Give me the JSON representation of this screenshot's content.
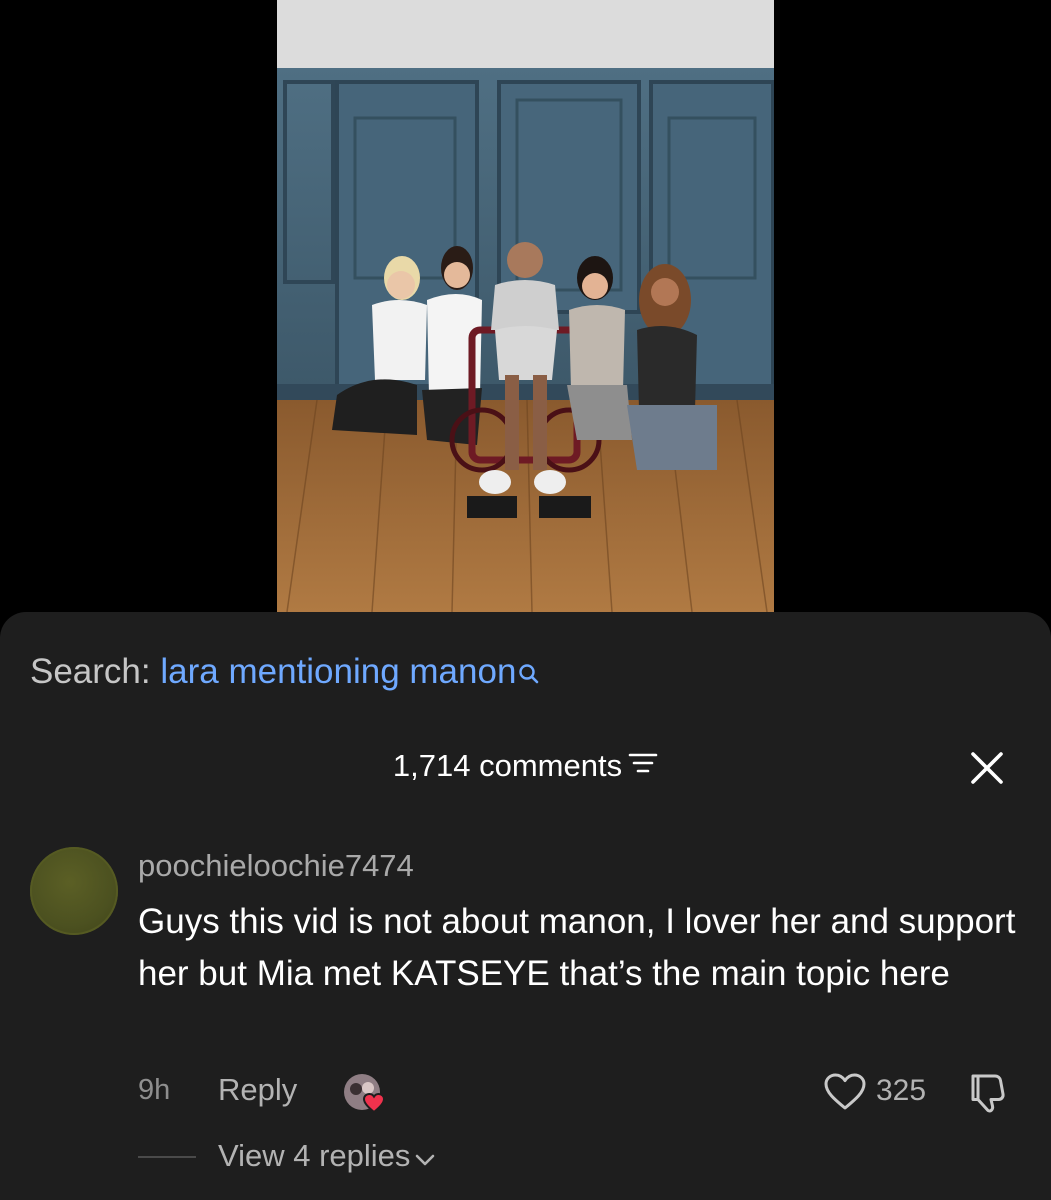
{
  "colors": {
    "background": "#000000",
    "sheet": "#1e1e1e",
    "link_blue": "#6fa9ff",
    "muted_text": "#a9a9a9",
    "like_red": "#f0324d"
  },
  "search": {
    "prefix": "Search:",
    "query": "lara mentioning manon",
    "icon": "search-icon"
  },
  "comments_header": {
    "count_label": "1,714 comments",
    "filter_icon": "filter-icon",
    "close_icon": "close-icon"
  },
  "comment": {
    "username": "poochieloochie7474",
    "text": "Guys this vid is not about manon, I lover her and support her but Mia met KATSEYE that’s the main topic here",
    "time": "9h",
    "reply_label": "Reply",
    "like_count": "325",
    "view_replies_label": "View 4 replies",
    "icons": [
      "heart-icon",
      "thumbs-down-icon",
      "chevron-down-icon"
    ]
  }
}
